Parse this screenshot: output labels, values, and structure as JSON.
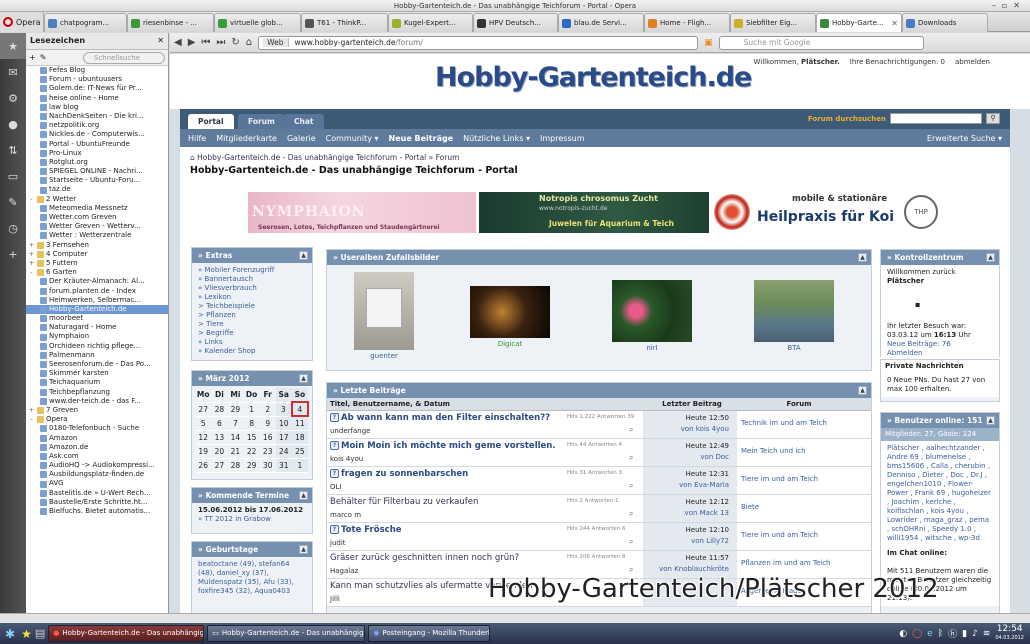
{
  "window": {
    "title": "Hobby-Gartenteich.de - Das unabhängige Teichforum - Portal - Opera"
  },
  "tabs": [
    {
      "label": "Opera"
    },
    {
      "label": "chatpogram..."
    },
    {
      "label": "riesenbinse - ..."
    },
    {
      "label": "virtuelle glob..."
    },
    {
      "label": "T61 - ThinkP..."
    },
    {
      "label": "Kugel-Expert..."
    },
    {
      "label": "HPV Deutsch..."
    },
    {
      "label": "blau.de Servi..."
    },
    {
      "label": "Home - Fligh..."
    },
    {
      "label": "Siebfilter Eig..."
    },
    {
      "label": "Hobby-Garte..."
    },
    {
      "label": "Downloads"
    }
  ],
  "bookmarks": {
    "title": "Lesezeichen",
    "search_placeholder": "Schnellsuche",
    "items": [
      {
        "label": "Fefes Blog",
        "type": "link",
        "level": 1
      },
      {
        "label": "Forum - ubuntuusers",
        "type": "link",
        "level": 1
      },
      {
        "label": "Golem.de: IT-News für Pr...",
        "type": "link",
        "level": 1
      },
      {
        "label": "heise online - Home",
        "type": "link",
        "level": 1
      },
      {
        "label": "law blog",
        "type": "link",
        "level": 1
      },
      {
        "label": "NachDenkSeiten - Die kri...",
        "type": "link",
        "level": 1
      },
      {
        "label": "netzpolitik.org",
        "type": "link",
        "level": 1
      },
      {
        "label": "Nickles.de - Computerwis...",
        "type": "link",
        "level": 1
      },
      {
        "label": "Portal - UbuntuFreunde",
        "type": "link",
        "level": 1
      },
      {
        "label": "Pro-Linux",
        "type": "link",
        "level": 1
      },
      {
        "label": "Rotglut.org",
        "type": "link",
        "level": 1
      },
      {
        "label": "SPIEGEL ONLINE - Nachri...",
        "type": "link",
        "level": 1
      },
      {
        "label": "Startseite - Ubuntu-Foru...",
        "type": "link",
        "level": 1
      },
      {
        "label": "taz.de",
        "type": "link",
        "level": 1
      },
      {
        "label": "2 Wetter",
        "type": "folder",
        "level": 0,
        "expand": "-"
      },
      {
        "label": "Meteomedia Messnetz",
        "type": "link",
        "level": 1
      },
      {
        "label": "Wetter.com Greven",
        "type": "link",
        "level": 1
      },
      {
        "label": "Wetter Greven - Wetterv...",
        "type": "link",
        "level": 1
      },
      {
        "label": "Wetter : Wetterzentrale",
        "type": "link",
        "level": 1
      },
      {
        "label": "3 Fernsehen",
        "type": "folder",
        "level": 0,
        "expand": "+"
      },
      {
        "label": "4 Computer",
        "type": "folder",
        "level": 0,
        "expand": "+"
      },
      {
        "label": "5 Futtern",
        "type": "folder",
        "level": 0,
        "expand": "+"
      },
      {
        "label": "6 Garten",
        "type": "folder",
        "level": 0,
        "expand": "-"
      },
      {
        "label": "Der Kräuter-Almanach: Al...",
        "type": "link",
        "level": 1
      },
      {
        "label": "forum.planten.de - Index",
        "type": "link",
        "level": 1
      },
      {
        "label": "Heimwerken, Selbermac...",
        "type": "link",
        "level": 1
      },
      {
        "label": "Hobby-Gartenteich.de",
        "type": "link",
        "level": 1,
        "selected": true
      },
      {
        "label": "moorbeet",
        "type": "link",
        "level": 1
      },
      {
        "label": "Naturagard - Home",
        "type": "link",
        "level": 1
      },
      {
        "label": "Nymphaion",
        "type": "link",
        "level": 1
      },
      {
        "label": "Orchideen richtig pflege...",
        "type": "link",
        "level": 1
      },
      {
        "label": "Palmenmann",
        "type": "link",
        "level": 1
      },
      {
        "label": "Seerosenforum.de - Das Po...",
        "type": "link",
        "level": 1
      },
      {
        "label": "Skimmer karsten",
        "type": "link",
        "level": 1
      },
      {
        "label": "Teichaquarium",
        "type": "link",
        "level": 1
      },
      {
        "label": "Teichbepflanzung",
        "type": "link",
        "level": 1
      },
      {
        "label": "www.der-teich.de - das F...",
        "type": "link",
        "level": 1
      },
      {
        "label": "7 Greven",
        "type": "folder",
        "level": 0,
        "expand": "+"
      },
      {
        "label": "Opera",
        "type": "folder",
        "level": 0,
        "expand": "-"
      },
      {
        "label": "0180-Telefonbuch - Suche",
        "type": "link",
        "level": 1
      },
      {
        "label": "Amazon",
        "type": "link",
        "level": 1
      },
      {
        "label": "Amazon.de",
        "type": "link",
        "level": 1
      },
      {
        "label": "Ask.com",
        "type": "link",
        "level": 1
      },
      {
        "label": "AudioHQ -> Audiokompressi...",
        "type": "link",
        "level": 1
      },
      {
        "label": "Ausbildungsplatz-finden.de",
        "type": "link",
        "level": 1
      },
      {
        "label": "AVG",
        "type": "link",
        "level": 1
      },
      {
        "label": "Bastelitis.de » U-Wert Rech...",
        "type": "link",
        "level": 1
      },
      {
        "label": "Baustelle/Erste Schritte.ht...",
        "type": "link",
        "level": 1
      },
      {
        "label": "Bielfuchs. Bietet automatis...",
        "type": "link",
        "level": 1
      }
    ]
  },
  "address": {
    "web_label": "Web",
    "host": "www.hobby-gartenteich.de",
    "path": "/forum/",
    "search_placeholder": "Suche mit Google"
  },
  "site": {
    "welcome": "Willkommen,",
    "user": "Plätscher.",
    "notifications": "Ihre Benachrichtigungen: 0",
    "logout": "abmelden",
    "logo": "Hobby-Gartenteich.de",
    "tabs": [
      "Portal",
      "Forum",
      "Chat"
    ],
    "forum_search": "Forum durchsuchen",
    "subnav": [
      "Hilfe",
      "Mitgliederkarte",
      "Galerie",
      "Community ▾",
      "Neue Beiträge",
      "Nützliche Links ▾",
      "Impressum"
    ],
    "advanced_search": "Erweiterte Suche ▾",
    "crumb1": "Hobby-Gartenteich.de - Das unabhängige Teichforum - Portal",
    "crumb2": "Forum",
    "page_title": "Hobby-Gartenteich.de - Das unabhängige Teichforum - Portal"
  },
  "banners": {
    "b1_title": "NYMPHAION",
    "b1_sub": "Seerosen, Lotos, Teichpflanzen und Staudengärtnerei",
    "b2_t1": "Notropis chrosomus Zucht",
    "b2_t2": "www.notropis-zucht.de",
    "b2_t3": "Juwelen für Aquarium & Teich",
    "b3_t1": "mobile & stationäre",
    "b3_t2": "Heilpraxis für Koi",
    "b3_logo": "THP"
  },
  "extras": {
    "title": "» Extras",
    "links": [
      "» Mobiler Forenzugriff",
      "» Bannertausch",
      "» Vliesverbrauch",
      "» Lexikon",
      "  > Teichbeispiele",
      "  > Pflanzen",
      "  > Tiere",
      "  > Begriffe",
      "» Links",
      "» Kalender Shop"
    ]
  },
  "calendar": {
    "title": "» März 2012",
    "days": [
      "Mo",
      "Di",
      "Mi",
      "Do",
      "Fr",
      "Sa",
      "So"
    ],
    "weeks": [
      [
        "27",
        "28",
        "29",
        "1",
        "2",
        "3",
        "4"
      ],
      [
        "5",
        "6",
        "7",
        "8",
        "9",
        "10",
        "11"
      ],
      [
        "12",
        "13",
        "14",
        "15",
        "16",
        "17",
        "18"
      ],
      [
        "19",
        "20",
        "21",
        "22",
        "23",
        "24",
        "25"
      ],
      [
        "26",
        "27",
        "28",
        "29",
        "30",
        "31",
        "1"
      ]
    ],
    "today": "4"
  },
  "terms": {
    "title": "» Kommende Termine",
    "date": "15.06.2012 bis 17.06.2012",
    "event": "» TT 2012 in Grabow"
  },
  "birthdays": {
    "title": "» Geburtstage",
    "text": "beatoctane (49), stefan64 (48), daniel_xy (37), Muldenspatz (35), Afu (33), foxfire345 (32), Aqua0403"
  },
  "album": {
    "title": "» Useralben Zufallsbilder",
    "items": [
      {
        "label": "guenter"
      },
      {
        "label": "Digicat"
      },
      {
        "label": "nirI"
      },
      {
        "label": "BTA"
      }
    ]
  },
  "latest": {
    "title": "» Letzte Beiträge",
    "col_title": "Titel, Benutzername, & Datum",
    "col_last": "Letzter Beitrag",
    "col_forum": "Forum",
    "rows": [
      {
        "title": "Ab wann kann man den Filter einschalten??",
        "starter": "underfange",
        "stats": "Hits 1.222   Antworten 39",
        "when": "Heute 12:50",
        "by": "von kois 4you",
        "forum": "Technik im und am Teich",
        "bold": true
      },
      {
        "title": "Moin Moin ich möchte mich geme vorstellen.",
        "starter": "kois 4you",
        "stats": "Hits 44   Antworten 4",
        "when": "Heute 12:49",
        "by": "von Doc",
        "forum": "Mein Teich und ich",
        "bold": true
      },
      {
        "title": "fragen zu sonnenbarschen",
        "starter": "OLI",
        "stats": "Hits 31   Antworten 3",
        "when": "Heute 12:31",
        "by": "von Eva-Maria",
        "forum": "Tiere im und am Teich",
        "bold": true
      },
      {
        "title": "Behälter für Filterbau zu verkaufen",
        "starter": "marco m",
        "stats": "Hits 2   Antworten 1",
        "when": "Heute 12:12",
        "by": "von Mack 13",
        "forum": "Biete",
        "bold": false
      },
      {
        "title": "Tote Frösche",
        "starter": "judit",
        "stats": "Hits 244   Antworten 6",
        "when": "Heute 12:10",
        "by": "von Lilly72",
        "forum": "Tiere im und am Teich",
        "bold": true
      },
      {
        "title": "Gräser zurück geschnitten innen noch grün?",
        "starter": "Hagalaz",
        "stats": "Hits 206   Antworten 8",
        "when": "Heute 11:57",
        "by": "von Knoblauchkröte",
        "forum": "Pflanzen im und am Teich",
        "bold": false
      },
      {
        "title": "Kann man schutzvlies als ufermatte verwenden",
        "starter": "Jilli",
        "stats": "",
        "when": "",
        "by": "",
        "forum": "Allgemeine Fragen",
        "bold": false
      }
    ]
  },
  "kontroll": {
    "title": "» Kontrollzentrum",
    "welcome": "Willkommen zurück",
    "user": "Plätscher",
    "lastvisit": "Ihr letzter Besuch war: 03.03.12 um",
    "lasttime": "16:13",
    "lastsuffix": "Uhr",
    "new": "Neue Beiträge: 76",
    "unsub": "Abmelden"
  },
  "pn": {
    "title": "Private Nachrichten",
    "text": "0 Neue PNs. Du hast 27 von max 100 erhalten."
  },
  "online": {
    "title": "» Benutzer online: 151",
    "sub": "Mitglieder: 27, Gäste: 124",
    "names": "Plätscher , aalhechtzander , Andre 69 , blumenelse , bms15606 , Calla , cherubin , Dennisо , Dieter , Doc , Dr.J , engelchen1010 , Flower-Power , Frank 69 , hugoheizer , Joachim , kerlche , koifischlan , kois 4you , Lowrider , maga_graz , pema , schOHRni , Speedy 1.0 , willi1954 , witsche , wp-3d",
    "chat_title": "Im Chat online:",
    "chat_text": "Mit 511 Benutzern waren die meisten Benutzer gleichzeitig online (30.01.2012 um 21:13)."
  },
  "watermark": "Hobby-Gartenteich/Plätscher 2012",
  "taskbar": {
    "items": [
      "Hobby-Gartenteich.de - Das unabhängige Teichf",
      "Hobby-Gartenteich.de - Das unabhängige Teich",
      "Posteingang - Mozilla Thunderbird"
    ],
    "time": "12:54",
    "date": "04.03.2012"
  }
}
